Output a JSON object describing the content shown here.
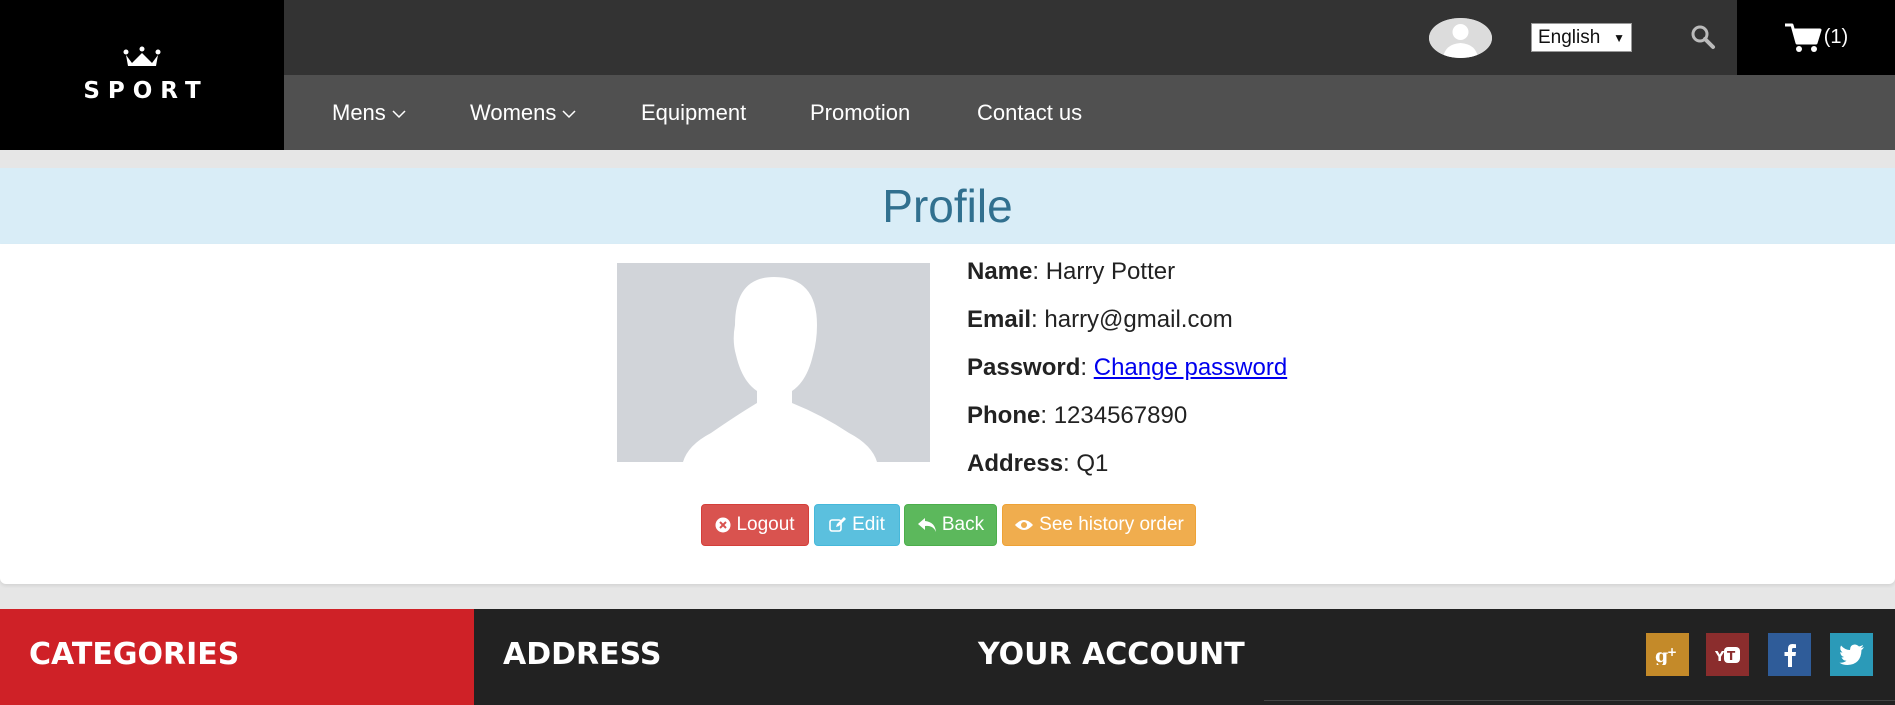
{
  "header": {
    "logo_text": "SPORT",
    "language": "English",
    "cart_count": "(1)"
  },
  "nav": {
    "items": [
      {
        "label": "Mens",
        "dropdown": true
      },
      {
        "label": "Womens",
        "dropdown": true
      },
      {
        "label": "Equipment",
        "dropdown": false
      },
      {
        "label": "Promotion",
        "dropdown": false
      },
      {
        "label": "Contact us",
        "dropdown": false
      }
    ]
  },
  "profile": {
    "title": "Profile",
    "fields": {
      "name_label": "Name",
      "name_value": "Harry Potter",
      "email_label": "Email",
      "email_value": "harry@gmail.com",
      "password_label": "Password",
      "password_link": "Change password",
      "phone_label": "Phone",
      "phone_value": "1234567890",
      "address_label": "Address",
      "address_value": "Q1"
    },
    "buttons": {
      "logout": "Logout",
      "edit": "Edit",
      "back": "Back",
      "history": "See history order"
    }
  },
  "footer": {
    "categories": "CATEGORIES",
    "address": "ADDRESS",
    "account": "YOUR ACCOUNT",
    "social": [
      {
        "icon": "google-plus-icon",
        "color": "#c48a29"
      },
      {
        "icon": "youtube-icon",
        "color": "#8b2d2d"
      },
      {
        "icon": "facebook-icon",
        "color": "#2f5c99"
      },
      {
        "icon": "twitter-icon",
        "color": "#2b9ab8"
      }
    ]
  },
  "colors": {
    "banner_bg": "#d9edf7",
    "banner_text": "#31708f",
    "categories_bg": "#cf2127"
  }
}
